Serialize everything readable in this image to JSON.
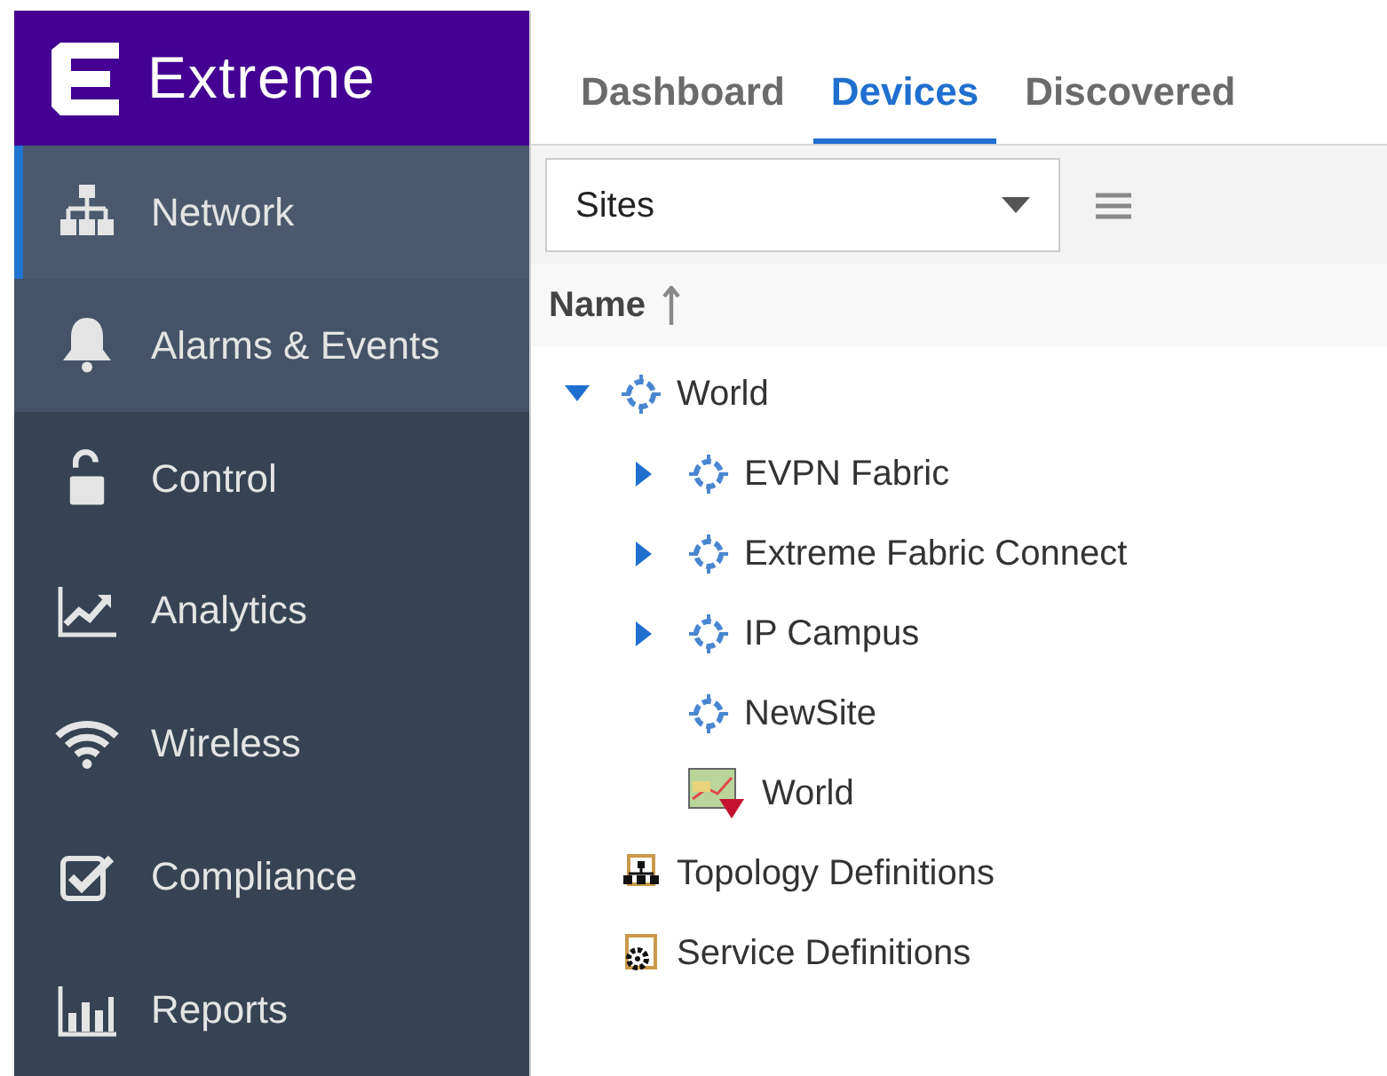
{
  "brand": {
    "name": "Extreme"
  },
  "sidebar": {
    "items": [
      {
        "label": "Network",
        "selected": true,
        "hovered": false
      },
      {
        "label": "Alarms & Events",
        "selected": false,
        "hovered": true
      },
      {
        "label": "Control",
        "selected": false,
        "hovered": false
      },
      {
        "label": "Analytics",
        "selected": false,
        "hovered": false
      },
      {
        "label": "Wireless",
        "selected": false,
        "hovered": false
      },
      {
        "label": "Compliance",
        "selected": false,
        "hovered": false
      },
      {
        "label": "Reports",
        "selected": false,
        "hovered": false
      }
    ]
  },
  "tabs": [
    {
      "label": "Dashboard",
      "selected": false
    },
    {
      "label": "Devices",
      "selected": true
    },
    {
      "label": "Discovered",
      "selected": false
    }
  ],
  "toolbar": {
    "dropdown": {
      "value": "Sites"
    }
  },
  "tree": {
    "column": "Name",
    "sorted_ascending": true,
    "nodes": [
      {
        "label": "World",
        "kind": "site",
        "expanded": true,
        "children": [
          {
            "label": "EVPN Fabric",
            "kind": "site",
            "expanded": false
          },
          {
            "label": "Extreme Fabric Connect",
            "kind": "site",
            "expanded": false
          },
          {
            "label": "IP Campus",
            "kind": "site",
            "expanded": false
          },
          {
            "label": "NewSite",
            "kind": "site"
          },
          {
            "label": "World",
            "kind": "map"
          }
        ]
      },
      {
        "label": "Topology Definitions",
        "kind": "topology"
      },
      {
        "label": "Service Definitions",
        "kind": "service"
      }
    ]
  }
}
